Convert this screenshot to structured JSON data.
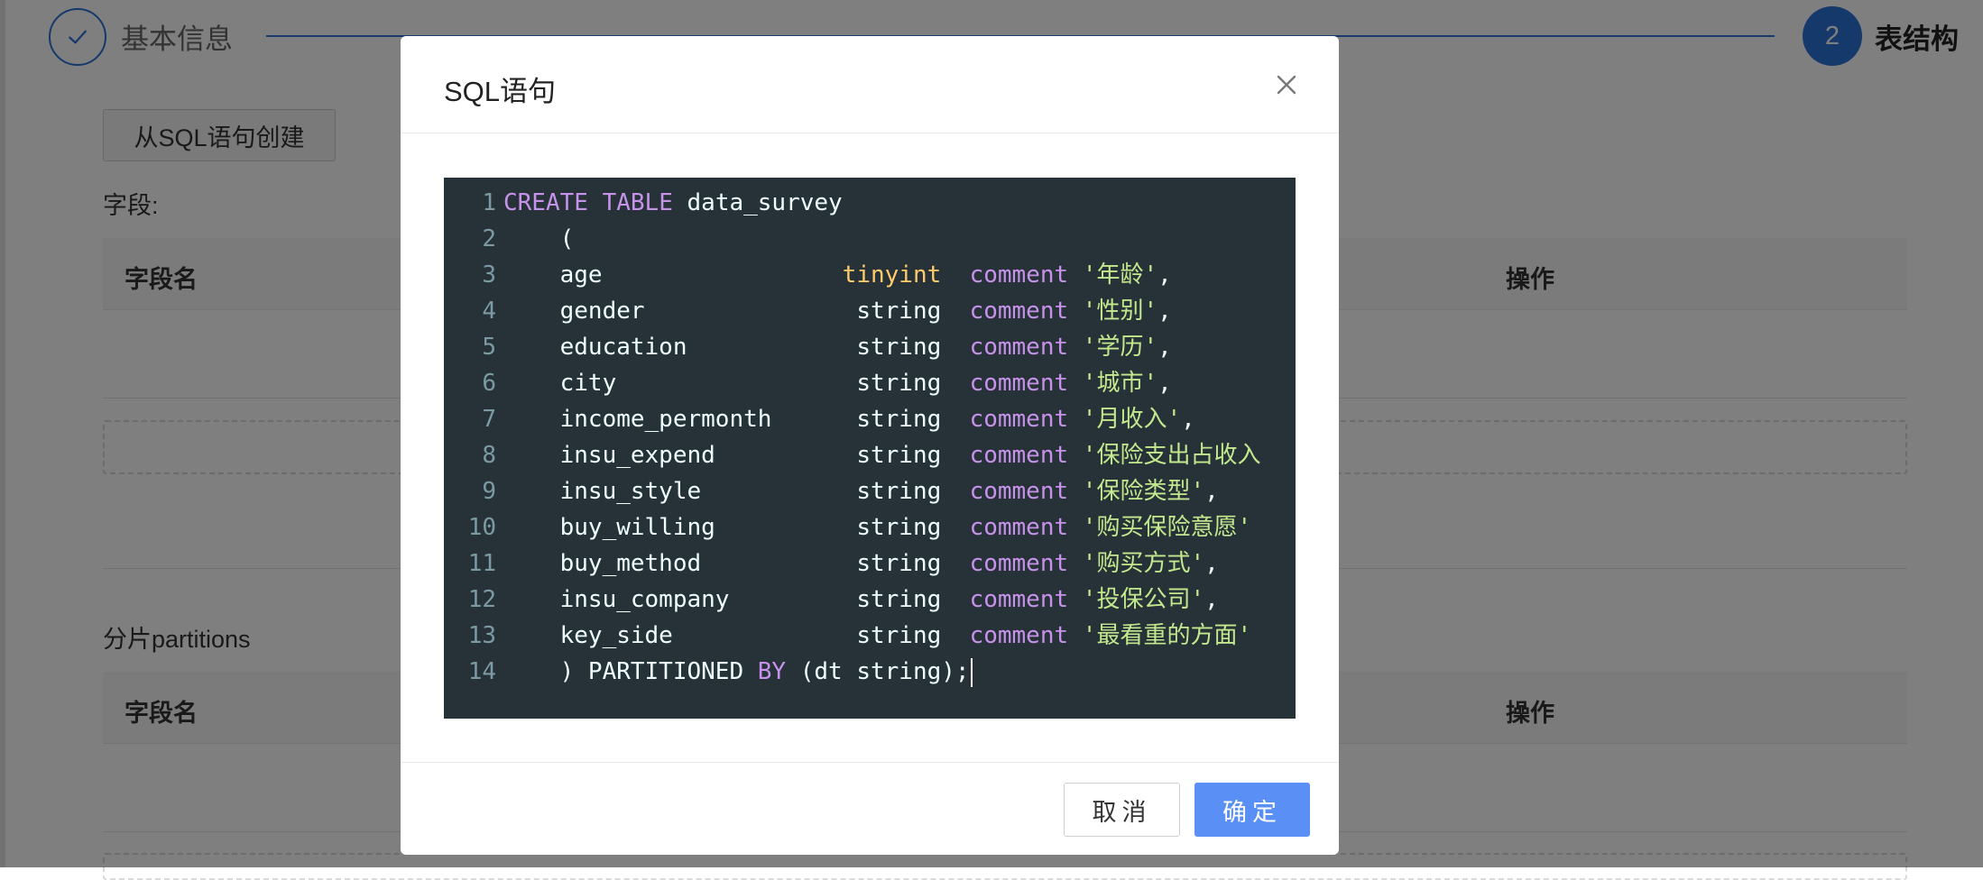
{
  "steps": {
    "step1_label": "基本信息",
    "step2_number": "2",
    "step2_label": "表结构"
  },
  "background": {
    "from_sql_button": "从SQL语句创建",
    "fields_label": "字段:",
    "fields_table": {
      "col_name": "字段名",
      "col_action": "操作"
    },
    "partitions_label": "分片partitions",
    "partitions_table": {
      "col_name": "字段名",
      "col_action": "操作"
    }
  },
  "modal": {
    "title": "SQL语句",
    "close_icon": "close-icon",
    "code_lines": [
      {
        "n": "1",
        "tokens": [
          {
            "t": "CREATE",
            "k": "kw"
          },
          {
            "t": " "
          },
          {
            "t": "TABLE",
            "k": "kw"
          },
          {
            "t": " data_survey"
          }
        ]
      },
      {
        "n": "2",
        "tokens": [
          {
            "t": "    ("
          }
        ]
      },
      {
        "n": "3",
        "tokens": [
          {
            "t": "    age                 "
          },
          {
            "t": "tinyint",
            "k": "type"
          },
          {
            "t": "  "
          },
          {
            "t": "comment",
            "k": "kw"
          },
          {
            "t": " "
          },
          {
            "t": "'年龄'",
            "k": "str"
          },
          {
            "t": ","
          }
        ]
      },
      {
        "n": "4",
        "tokens": [
          {
            "t": "    gender               string  "
          },
          {
            "t": "comment",
            "k": "kw"
          },
          {
            "t": " "
          },
          {
            "t": "'性别'",
            "k": "str"
          },
          {
            "t": ","
          }
        ]
      },
      {
        "n": "5",
        "tokens": [
          {
            "t": "    education            string  "
          },
          {
            "t": "comment",
            "k": "kw"
          },
          {
            "t": " "
          },
          {
            "t": "'学历'",
            "k": "str"
          },
          {
            "t": ","
          }
        ]
      },
      {
        "n": "6",
        "tokens": [
          {
            "t": "    city                 string  "
          },
          {
            "t": "comment",
            "k": "kw"
          },
          {
            "t": " "
          },
          {
            "t": "'城市'",
            "k": "str"
          },
          {
            "t": ","
          }
        ]
      },
      {
        "n": "7",
        "tokens": [
          {
            "t": "    income_permonth      string  "
          },
          {
            "t": "comment",
            "k": "kw"
          },
          {
            "t": " "
          },
          {
            "t": "'月收入'",
            "k": "str"
          },
          {
            "t": ","
          }
        ]
      },
      {
        "n": "8",
        "tokens": [
          {
            "t": "    insu_expend          string  "
          },
          {
            "t": "comment",
            "k": "kw"
          },
          {
            "t": " "
          },
          {
            "t": "'保险支出占收入",
            "k": "str"
          }
        ]
      },
      {
        "n": "9",
        "tokens": [
          {
            "t": "    insu_style           string  "
          },
          {
            "t": "comment",
            "k": "kw"
          },
          {
            "t": " "
          },
          {
            "t": "'保险类型'",
            "k": "str"
          },
          {
            "t": ","
          }
        ]
      },
      {
        "n": "10",
        "tokens": [
          {
            "t": "    buy_willing          string  "
          },
          {
            "t": "comment",
            "k": "kw"
          },
          {
            "t": " "
          },
          {
            "t": "'购买保险意愿'",
            "k": "str"
          }
        ]
      },
      {
        "n": "11",
        "tokens": [
          {
            "t": "    buy_method           string  "
          },
          {
            "t": "comment",
            "k": "kw"
          },
          {
            "t": " "
          },
          {
            "t": "'购买方式'",
            "k": "str"
          },
          {
            "t": ","
          }
        ]
      },
      {
        "n": "12",
        "tokens": [
          {
            "t": "    insu_company         string  "
          },
          {
            "t": "comment",
            "k": "kw"
          },
          {
            "t": " "
          },
          {
            "t": "'投保公司'",
            "k": "str"
          },
          {
            "t": ","
          }
        ]
      },
      {
        "n": "13",
        "tokens": [
          {
            "t": "    key_side             string  "
          },
          {
            "t": "comment",
            "k": "kw"
          },
          {
            "t": " "
          },
          {
            "t": "'最看重的方面'",
            "k": "str"
          }
        ]
      },
      {
        "n": "14",
        "tokens": [
          {
            "t": "    ) PARTITIONED "
          },
          {
            "t": "BY",
            "k": "kw"
          },
          {
            "t": " (dt string);"
          }
        ]
      }
    ],
    "cancel_label": "取消",
    "ok_label": "确定"
  },
  "colors": {
    "accent": "#2d72d9",
    "primary_button": "#5a8ff5",
    "editor_bg": "#263238",
    "keyword": "#c792ea",
    "type": "#ffcb6b",
    "string": "#c3e88d",
    "line_number": "#7b9aa3"
  }
}
